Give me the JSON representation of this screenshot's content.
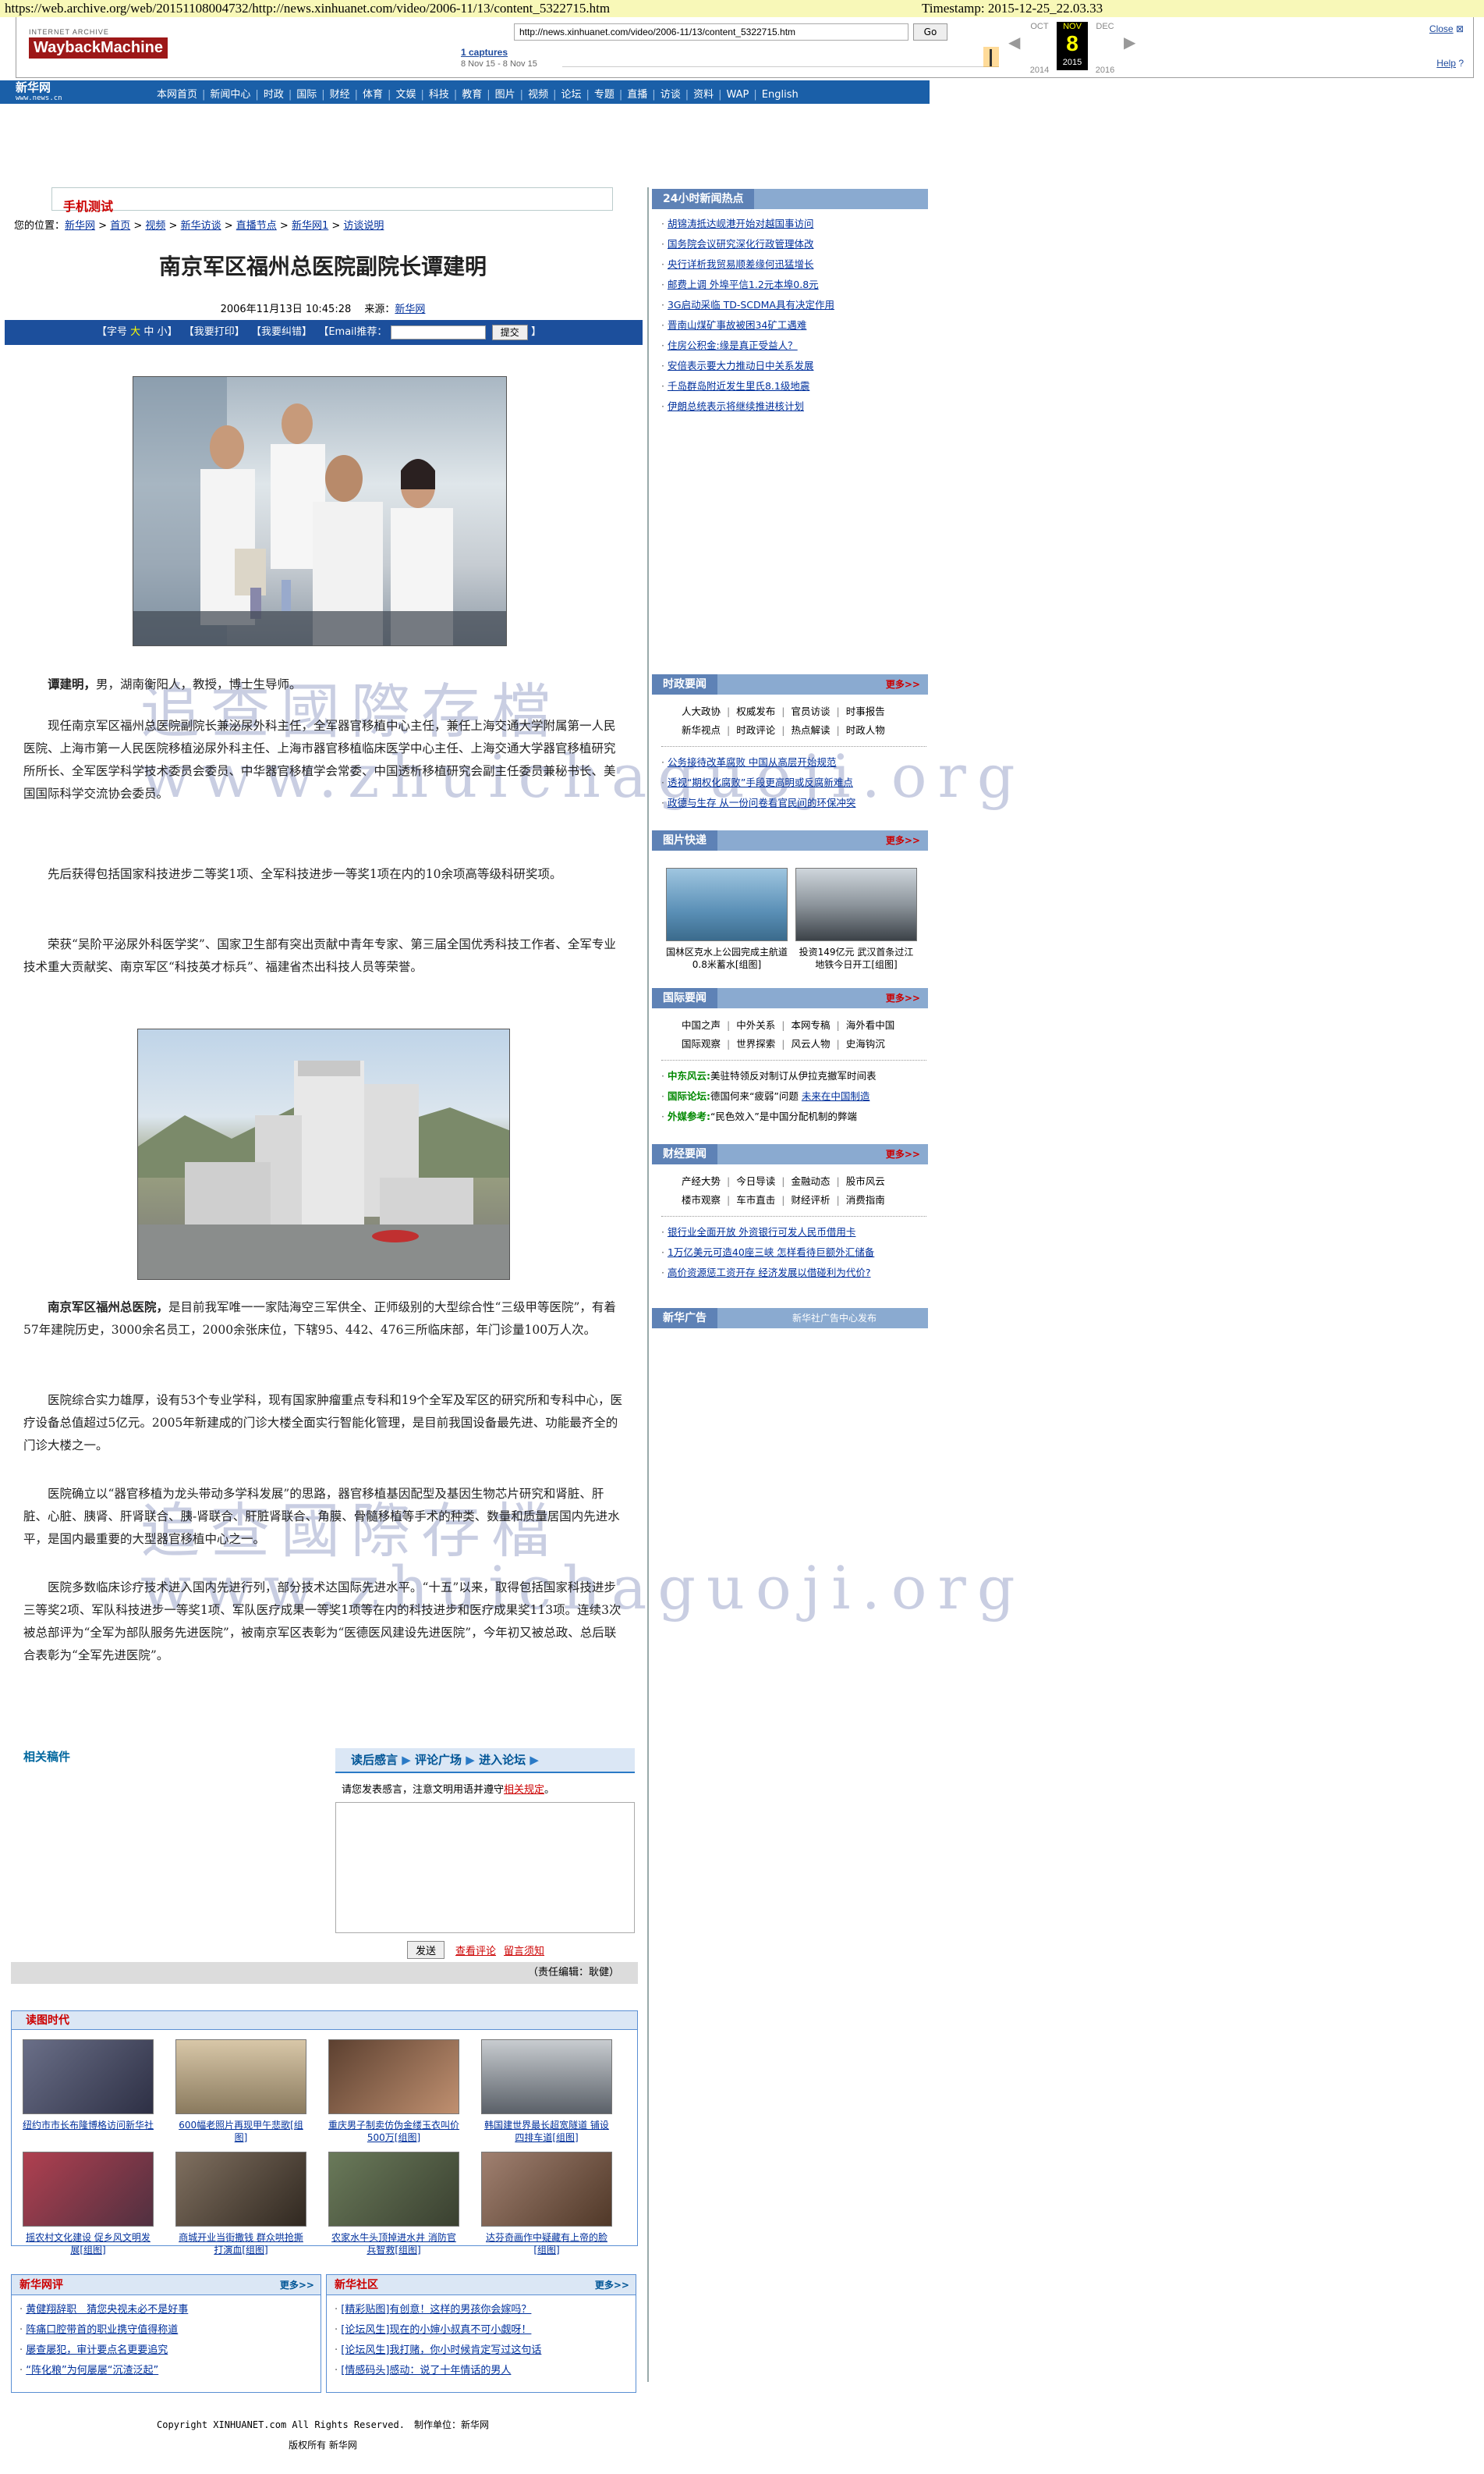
{
  "wayback": {
    "archive_url": "https://web.archive.org/web/20151108004732/http://news.xinhuanet.com/video/2006-11/13/content_5322715.htm",
    "timestamp": "Timestamp: 2015-12-25_22.03.33",
    "logo_top": "INTERNET ARCHIVE",
    "logo_main": "WaybackMachine",
    "url_value": "http://news.xinhuanet.com/video/2006-11/13/content_5322715.htm",
    "go": "Go",
    "captures": "1 captures",
    "capture_range": "8 Nov 15 - 8 Nov 15",
    "month_prev": "OCT",
    "month_cur": "NOV",
    "month_next": "DEC",
    "day": "8",
    "year_prev": "2014",
    "year_cur": "2015",
    "year_next": "2016",
    "close": "Close",
    "help": "Help"
  },
  "site": {
    "logo": "新华网",
    "logo_sub": "www.news.cn",
    "nav": [
      "本网首页",
      "新闻中心",
      "时政",
      "国际",
      "财经",
      "体育",
      "文娱",
      "科技",
      "教育",
      "图片",
      "视频",
      "论坛",
      "专题",
      "直播",
      "访谈",
      "资料",
      "WAP",
      "English"
    ]
  },
  "article": {
    "ad_text": "手机测试",
    "breadcrumb_label": "您的位置：",
    "breadcrumb": [
      "新华网",
      "首页",
      "视频",
      "新华访谈",
      "直播节点",
      "新华网1",
      "访谈说明"
    ],
    "title": "南京军区福州总医院副院长谭建明",
    "date": "2006年11月13日 10:45:28",
    "source_label": "来源：",
    "source": "新华网",
    "toolbar": {
      "font": "【字号",
      "big": "大",
      "mid": "中",
      "small": "小】",
      "print": "【我要打印】",
      "error": "【我要纠错】",
      "email": "【Email推荐：",
      "submit": "提交",
      "end": "】"
    },
    "p1_name": "谭建明，",
    "p1": "男，湖南衡阳人，教授，博士生导师。",
    "p2": "现任南京军区福州总医院副院长兼泌尿外科主任，全军器官移植中心主任，兼任上海交通大学附属第一人民医院、上海市第一人民医院移植泌尿外科主任、上海市器官移植临床医学中心主任、上海交通大学器官移植研究所所长、全军医学科学技术委员会委员、中华器官移植学会常委、中国透析移植研究会副主任委员兼秘书长、美国国际科学交流协会委员。",
    "p3": "先后获得包括国家科技进步二等奖1项、全军科技进步一等奖1项在内的10余项高等级科研奖项。",
    "p4": "荣获“吴阶平泌尿外科医学奖”、国家卫生部有突出贡献中青年专家、第三届全国优秀科技工作者、全军专业技术重大贡献奖、南京军区“科技英才标兵”、福建省杰出科技人员等荣誉。",
    "p5_name": "南京军区福州总医院，",
    "p5": "是目前我军唯一一家陆海空三军供全、正师级别的大型综合性“三级甲等医院”，有着57年建院历史，3000余名员工，2000余张床位，下辖95、442、476三所临床部，年门诊量100万人次。",
    "p6": "医院综合实力雄厚，设有53个专业学科，现有国家肿瘤重点专科和19个全军及军区的研究所和专科中心，医疗设备总值超过5亿元。2005年新建成的门诊大楼全面实行智能化管理，是目前我国设备最先进、功能最齐全的门诊大楼之一。",
    "p7": "医院确立以“器官移植为龙头带动多学科发展”的思路，器官移植基因配型及基因生物芯片研究和肾脏、肝脏、心脏、胰肾、肝肾联合、胰-肾联合、肝脏肾联合、角膜、骨髓移植等手术的种类、数量和质量居国内先进水平，是国内最重要的大型器官移植中心之一。",
    "p8": "医院多数临床诊疗技术进入国内先进行列，部分技术达国际先进水平。“十五”以来，取得包括国家科技进步三等奖2项、军队科技进步一等奖1项、军队医疗成果一等奖1项等在内的科技进步和医疗成果奖113项。连续3次被总部评为“全军为部队服务先进医院”，被南京军区表彰为“医德医风建设先进医院”，今年初又被总政、总后联合表彰为“全军先进医院”。",
    "watermark1": "追查國際存檔",
    "watermark2": "www.zhuichaguoji.org"
  },
  "comments": {
    "related": "相关稿件",
    "tabs": [
      "读后感言",
      "评论广场",
      "进入论坛"
    ],
    "note": "请您发表感言，注意文明用语并遵守",
    "note_link": "相关规定",
    "note_end": "。",
    "submit": "发送",
    "view": "查看评论",
    "notice": "留言须知"
  },
  "editor": "（责任编辑：耿健）",
  "pic_section": {
    "title": "读图时代",
    "items": [
      "纽约市市长布隆博格访问新华社",
      "600幅老照片再现甲午悲歌[组图]",
      "重庆男子制卖仿伪金缕玉衣叫价500万[组图]",
      "韩国建世界最长超宽隧道 铺设四排车道[组图]",
      "摇农村文化建设 促乡风文明发展[组图]",
      "商城开业当街撒钱 群众哄抢撕打演血[组图]",
      "农家水牛头顶掉进水井 消防官兵智救[组图]",
      "达芬奇画作中疑藏有上帝的脸[组图]"
    ]
  },
  "bottom": {
    "left_title": "新华网评",
    "left_more": "更多>>",
    "left_items": [
      "黄健翔辞职　猜您央视未必不是好事",
      "阵痛口腔带首的职业携守值得称道",
      "屡查屡犯，审计要点名更要追究",
      "“阵化粮”为何屡屡“沉渣泛起”"
    ],
    "right_title": "新华社区",
    "right_more": "更多>>",
    "right_items": [
      "[精彩贴图]有创意！这样的男孩你会嫁吗？",
      "[论坛风生]现在的小婶小叔真不可小觑呀！",
      "[论坛风生]我打赌，你小时候肯定写过这句话",
      "[情感码头]感动：说了十年情话的男人"
    ]
  },
  "footer": {
    "copyright": "Copyright XINHUANET.com  All Rights Reserved.",
    "maker": "制作单位：新华网",
    "rights": "版权所有 新华网"
  },
  "right": {
    "hot_title": "24小时新闻热点",
    "hot": [
      "胡锦涛抵达岘港开始对越国事访问",
      "国务院会议研究深化行政管理体改",
      "央行详析我贸易顺差缘何迅猛增长",
      "邮费上调 外埠平信1.2元本埠0.8元",
      "3G启动采临 TD-SCDMA具有决定作用",
      "晋南山煤矿事故被困34矿工遇难",
      "住房公积金:缘是真正受益人？",
      "安倍表示要大力推动日中关系发展",
      "千岛群岛附近发生里氏8.1级地震",
      "伊朗总统表示将继续推进核计划"
    ],
    "zs_title": "时政要闻",
    "more": "更多>>",
    "zs_sub": [
      "人大政协",
      "权威发布",
      "官员访谈",
      "时事报告",
      "新华视点",
      "时政评论",
      "热点解读",
      "时政人物"
    ],
    "zs_items": [
      "公务接待改革腐败 中国从高层开始规范",
      "透视“期权化腐败”手段更高明或反腐新难点",
      "政德与生存 从一份问卷看官民间的环保冲突"
    ],
    "pic_title": "图片快递",
    "pic_items": [
      "国林区克水上公园完成主航道0.8米蓄水[组图]",
      "投资149亿元 武汉首条过江地铁今日开工[组图]"
    ],
    "gj_title": "国际要闻",
    "gj_sub": [
      "中国之声",
      "中外关系",
      "本网专稿",
      "海外看中国",
      "国际观察",
      "世界探索",
      "风云人物",
      "史海钩沉"
    ],
    "gj_items": [
      {
        "tag": "中东风云:",
        "text": "美驻特领反对制订从伊拉克撤军时间表"
      },
      {
        "tag": "国际论坛:",
        "text": "德国何来“疲弱”问题 ",
        "link": "未来在中国制造"
      },
      {
        "tag": "外媒参考:",
        "text": "“民色效入”是中国分配机制的弊端"
      }
    ],
    "cj_title": "财经要闻",
    "cj_sub": [
      "产经大势",
      "今日导读",
      "金融动态",
      "股市风云",
      "楼市观察",
      "车市直击",
      "财经评析",
      "消费指南"
    ],
    "cj_items": [
      "银行业全面开放 外资银行可发人民币借用卡",
      "1万亿美元可造40座三峡 怎样看待巨额外汇储备",
      "高价资源惩工资开存 经济发展以借碰利为代价?"
    ],
    "ad_title": "新华广告",
    "ad_text": "新华社广告中心发布"
  }
}
